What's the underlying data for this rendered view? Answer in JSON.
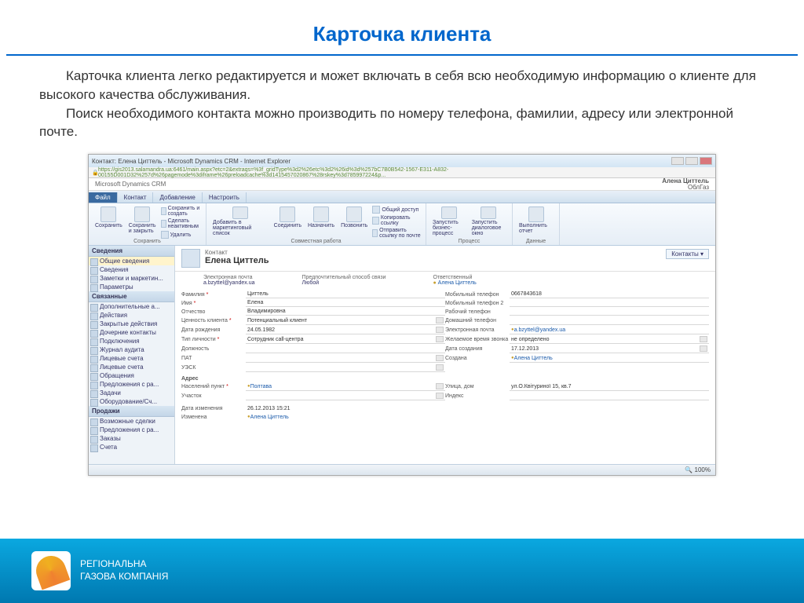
{
  "slide": {
    "title": "Карточка клиента",
    "desc1": "Карточка  клиента легко редактируется и может включать  в себя всю необходимую информацию о клиенте для высокого качества обслуживания.",
    "desc2": "Поиск необходимого контакта можно производить по номеру телефона, фамилии, адресу или электронной почте."
  },
  "window": {
    "title": "Контакт: Елена Циттель - Microsoft Dynamics CRM - Internet Explorer",
    "url": "https://gis2013.salamandra.ua:6461/main.aspx?etc=2&extraqs=%3f_gridType%3d2%26etc%3d2%26id%3d%257bC7B0B542-1567-E311-A832-00155D001D32%257d%26pagemode%3diframe%26preloadcache%3d1415457020867%28rskey%3d785997224&p...",
    "brand": "Microsoft Dynamics CRM",
    "user_name": "Алена Циттель",
    "user_org": "ОблГаз"
  },
  "tabs": [
    "Файл",
    "Контакт",
    "Добавление",
    "Настроить"
  ],
  "ribbon": {
    "g1_label": "Сохранить",
    "save": "Сохранить",
    "save_close": "Сохранить и закрыть",
    "save_new": "Сохранить и создать",
    "make_inactive": "Сделать неактивным",
    "delete": "Удалить",
    "g2_label": "Совместная работа",
    "add_marketing": "Добавить в маркетинговый список",
    "connect": "Соединить",
    "assign": "Назначить",
    "call": "Позвонить",
    "share": "Общий доступ",
    "copy_link": "Копировать ссылку",
    "send_link": "Отправить ссылку по почте",
    "g3_label": "Процесс",
    "run_process": "Запустить бизнес-процесс",
    "run_dialog": "Запустить диалоговое окно",
    "g4_label": "Данные",
    "run_report": "Выполнить отчет"
  },
  "sidebar": {
    "h1": "Сведения",
    "s1": [
      "Общие сведения",
      "Сведения",
      "Заметки и маркетин...",
      "Параметры"
    ],
    "h2": "Связанные",
    "s2": [
      "Дополнительные а...",
      "Действия",
      "Закрытые действия",
      "Дочерние контакты",
      "Подключения",
      "Журнал аудита",
      "Лицевые счета",
      "Лицевые счета",
      "Обращения",
      "Предложения с ра...",
      "Задачи",
      "Оборудование/Сч..."
    ],
    "h3": "Продажи",
    "s3": [
      "Возможные сделки",
      "Предложения с ра...",
      "Заказы",
      "Счета"
    ]
  },
  "card": {
    "type": "Контакт",
    "name": "Елена Циттель",
    "btn": "Контакты",
    "sum": {
      "email_lbl": "Электронная почта",
      "email": "a.bzyttel@yandex.ua",
      "call_lbl": "Предпочтительный способ связи",
      "call": "Любой",
      "owner_lbl": "Ответственный",
      "owner": "Алена Циттель"
    }
  },
  "form": {
    "lastname_lbl": "Фамилия",
    "lastname": "Циттель",
    "firstname_lbl": "Имя",
    "firstname": "Елена",
    "middle_lbl": "Отчество",
    "middle": "Владимировна",
    "value_lbl": "Ценность клиента",
    "value": "Потенциальный клиент",
    "birth_lbl": "Дата рождения",
    "birth": "24.05.1982",
    "type_lbl": "Тип личности",
    "type": "Сотрудник call-центра",
    "position_lbl": "Должность",
    "position": "",
    "pat_lbl": "ПАТ",
    "pat": "",
    "usk_lbl": "УЭСК",
    "usk": "",
    "addr_lbl": "Адрес",
    "city_lbl": "Населений пункт",
    "city": "Полтава",
    "district_lbl": "Участок",
    "district": "",
    "mobile_lbl": "Мобильный телефон",
    "mobile": "0667843618",
    "mobile2_lbl": "Мобильный телефон 2",
    "mobile2": "",
    "work_lbl": "Рабочий телефон",
    "work": "",
    "home_lbl": "Домашний телефон",
    "home": "",
    "email2_lbl": "Электронная почта",
    "email2": "a.bzyttel@yandex.ua",
    "calltime_lbl": "Желаемое время звонка",
    "calltime": "не определено",
    "created_lbl": "Дата создания",
    "created": "17.12.2013",
    "creator_lbl": "Создана",
    "creator": "Алена Циттель",
    "street_lbl": "Улица, дом",
    "street": "ул.О.Квітуриної 15, кв.7",
    "index_lbl": "Индекс",
    "index": "",
    "modified_lbl": "Дата изменения",
    "modified": "26.12.2013 15:21",
    "changed_lbl": "Изменена",
    "changed": "Алена Циттель"
  },
  "status": {
    "zoom": "100%"
  },
  "footer": {
    "l1": "РЕГІОНАЛЬНА",
    "l2": "ГАЗОВА КОМПАНІЯ"
  }
}
